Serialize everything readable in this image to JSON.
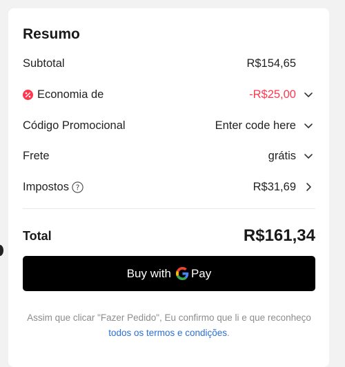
{
  "summary": {
    "title": "Resumo",
    "rows": [
      {
        "label": "Subtotal",
        "value": ""
      },
      {
        "label": "Economia de",
        "value": "-R$25,00"
      },
      {
        "label": "Código Promocional",
        "value": "Enter code here"
      },
      {
        "label": "Frete",
        "value": "grátis"
      },
      {
        "label": "Impostos",
        "value": "R$31,69"
      }
    ],
    "subtotal_value": "R$154,65",
    "total_label": "Total",
    "total_value": "R$161,34"
  },
  "payment": {
    "button_prefix": "Buy with",
    "button_suffix": "Pay"
  },
  "terms": {
    "text": "Assim que clicar \"Fazer Pedido\", Eu confirmo que li e que reconheço",
    "link": "todos os termos e condições",
    "end": "."
  },
  "colors": {
    "discount": "#fd384f",
    "link": "#2a6fd6",
    "button_bg": "#000000"
  }
}
